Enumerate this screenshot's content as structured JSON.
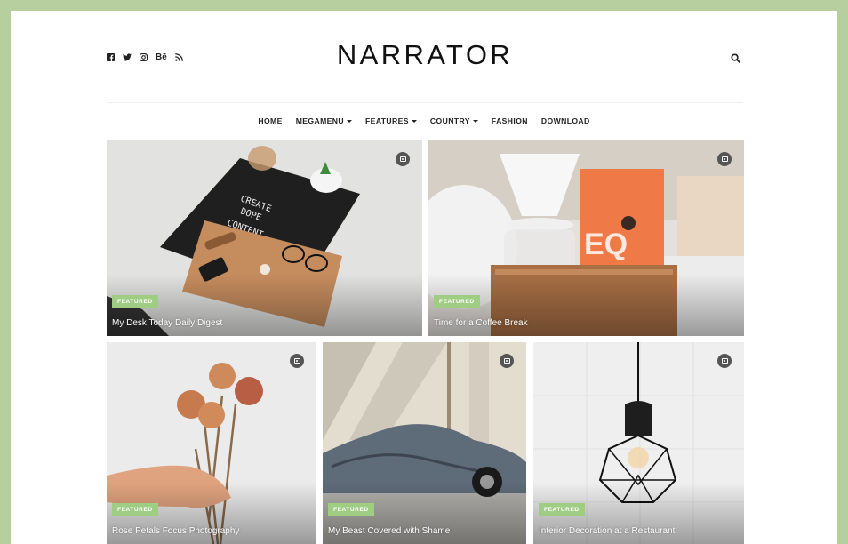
{
  "site": {
    "logo": "NARRATOR",
    "colors": {
      "page_bg": "#b7cf9f",
      "badge": "#9fcd84"
    }
  },
  "social": [
    {
      "name": "facebook-icon",
      "glyph": "f"
    },
    {
      "name": "twitter-icon",
      "glyph": "t"
    },
    {
      "name": "instagram-icon",
      "glyph": "ig"
    },
    {
      "name": "behance-icon",
      "glyph": "Bē"
    },
    {
      "name": "rss-icon",
      "glyph": "rss"
    }
  ],
  "nav": [
    {
      "label": "HOME",
      "dropdown": false
    },
    {
      "label": "MEGAMENU",
      "dropdown": true
    },
    {
      "label": "FEATURES",
      "dropdown": true
    },
    {
      "label": "COUNTRY",
      "dropdown": true
    },
    {
      "label": "FASHION",
      "dropdown": false
    },
    {
      "label": "DOWNLOAD",
      "dropdown": false
    }
  ],
  "posts": [
    {
      "badge": "FEATURED",
      "title": "My Desk Today Daily Digest",
      "media_icon": "camera-icon"
    },
    {
      "badge": "FEATURED",
      "title": "Time for a Coffee Break",
      "media_icon": "camera-icon"
    },
    {
      "badge": "FEATURED",
      "title": "Rose Petals Focus Photography",
      "media_icon": "camera-icon"
    },
    {
      "badge": "FEATURED",
      "title": "My Beast Covered with Shame",
      "media_icon": "camera-icon"
    },
    {
      "badge": "FEATURED",
      "title": "Interior Decoration at a Restaurant",
      "media_icon": "camera-icon"
    }
  ]
}
